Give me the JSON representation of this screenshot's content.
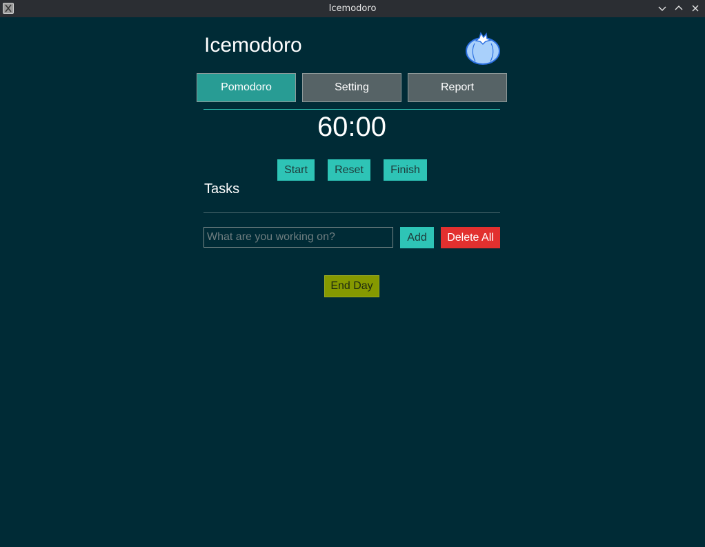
{
  "window": {
    "title": "Icemodoro",
    "controls": [
      "chevron-down-icon",
      "chevron-up-icon",
      "close-icon"
    ]
  },
  "app": {
    "title": "Icemodoro",
    "logo_icon": "tomato-icon"
  },
  "nav": {
    "tabs": [
      {
        "label": "Pomodoro",
        "active": true
      },
      {
        "label": "Setting",
        "active": false
      },
      {
        "label": "Report",
        "active": false
      }
    ]
  },
  "timer": {
    "display": "60:00",
    "start_label": "Start",
    "reset_label": "Reset",
    "finish_label": "Finish"
  },
  "tasks": {
    "heading": "Tasks",
    "input_value": "",
    "input_placeholder": "What are you working on?",
    "add_label": "Add",
    "delete_all_label": "Delete All",
    "end_day_label": "End Day"
  },
  "colors": {
    "background": "#002b36",
    "accent_teal": "#2ec4b6",
    "active_tab": "#289c94",
    "inactive_tab": "#566366",
    "danger": "#e2302f",
    "end_day": "#859900",
    "logo": "#5b9cf6"
  }
}
